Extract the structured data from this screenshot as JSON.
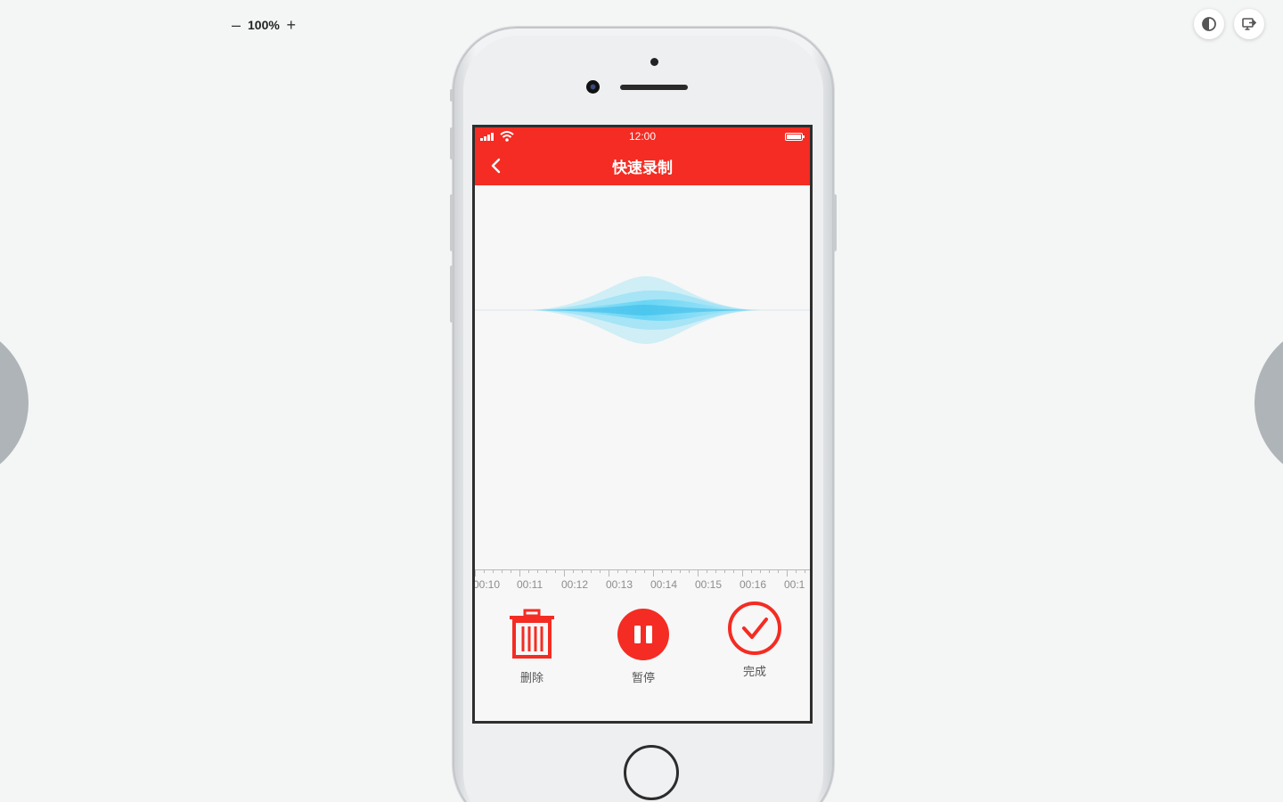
{
  "toolbar": {
    "zoom_level": "100%",
    "zoom_out": "–",
    "zoom_in": "+"
  },
  "status_bar": {
    "time": "12:00"
  },
  "header": {
    "title": "快速录制"
  },
  "timeline": {
    "labels": [
      "00:10",
      "00:11",
      "00:12",
      "00:13",
      "00:14",
      "00:15",
      "00:16",
      "00:1"
    ]
  },
  "controls": {
    "delete_label": "删除",
    "pause_label": "暂停",
    "done_label": "完成"
  },
  "colors": {
    "accent": "#f42c23",
    "wave": "#59d2f5"
  },
  "icons": [
    "back-arrow-icon",
    "trash-icon",
    "pause-icon",
    "check-circle-icon",
    "contrast-icon",
    "exit-fullscreen-icon"
  ]
}
